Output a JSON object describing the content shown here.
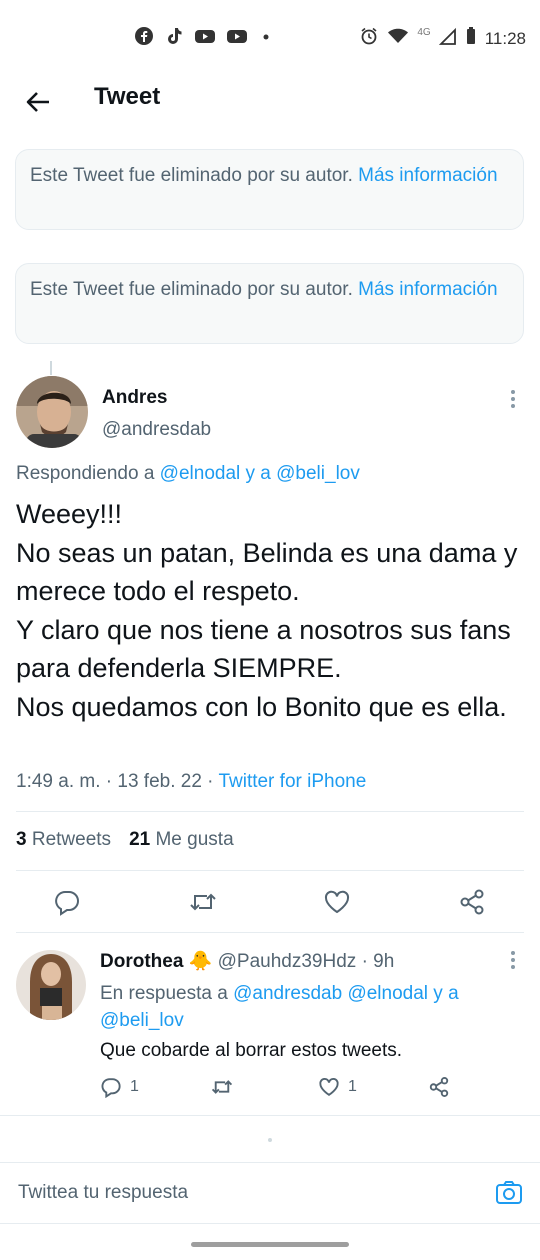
{
  "status_bar": {
    "time": "11:28",
    "network": "4G",
    "notification_icons": [
      "facebook-icon",
      "tiktok-icon",
      "youtube-icon",
      "youtube-icon",
      "dot-icon"
    ]
  },
  "header": {
    "title": "Tweet"
  },
  "deleted_tweets": [
    {
      "text": "Este Tweet fue eliminado por su autor. ",
      "link": "Más información"
    },
    {
      "text": "Este Tweet fue eliminado por su autor. ",
      "link": "Más información"
    }
  ],
  "tweet": {
    "author_name": "Andres",
    "author_handle": "@andresdab",
    "replying_prefix": "Respondiendo a ",
    "replying_users": "@elnodal y a @beli_lov",
    "text": "Weeey!!!\nNo seas un patan, Belinda es una dama y merece todo el respeto.\nY claro que nos tiene a nosotros sus fans para defenderla SIEMPRE.\nNos quedamos con lo Bonito que es ella.",
    "time": "1:49 a. m. · 13 feb. 22 · ",
    "source": "Twitter for iPhone",
    "retweets_count": "3",
    "retweets_label": "Retweets",
    "likes_count": "21",
    "likes_label": "Me gusta"
  },
  "reply": {
    "name": "Dorothea",
    "emoji": "🐥",
    "handle_time": "@Pauhdz39Hdz · 9h",
    "in_reply_prefix": "En respuesta a ",
    "in_reply_users": "@andresdab @elnodal y a @beli_lov",
    "text": "Que cobarde al borrar estos tweets.",
    "reply_count": "1",
    "like_count": "1"
  },
  "compose": {
    "placeholder": "Twittea tu respuesta"
  },
  "colors": {
    "accent": "#1d9bf0",
    "secondary_text": "#536471",
    "primary_text": "#0f1419"
  }
}
